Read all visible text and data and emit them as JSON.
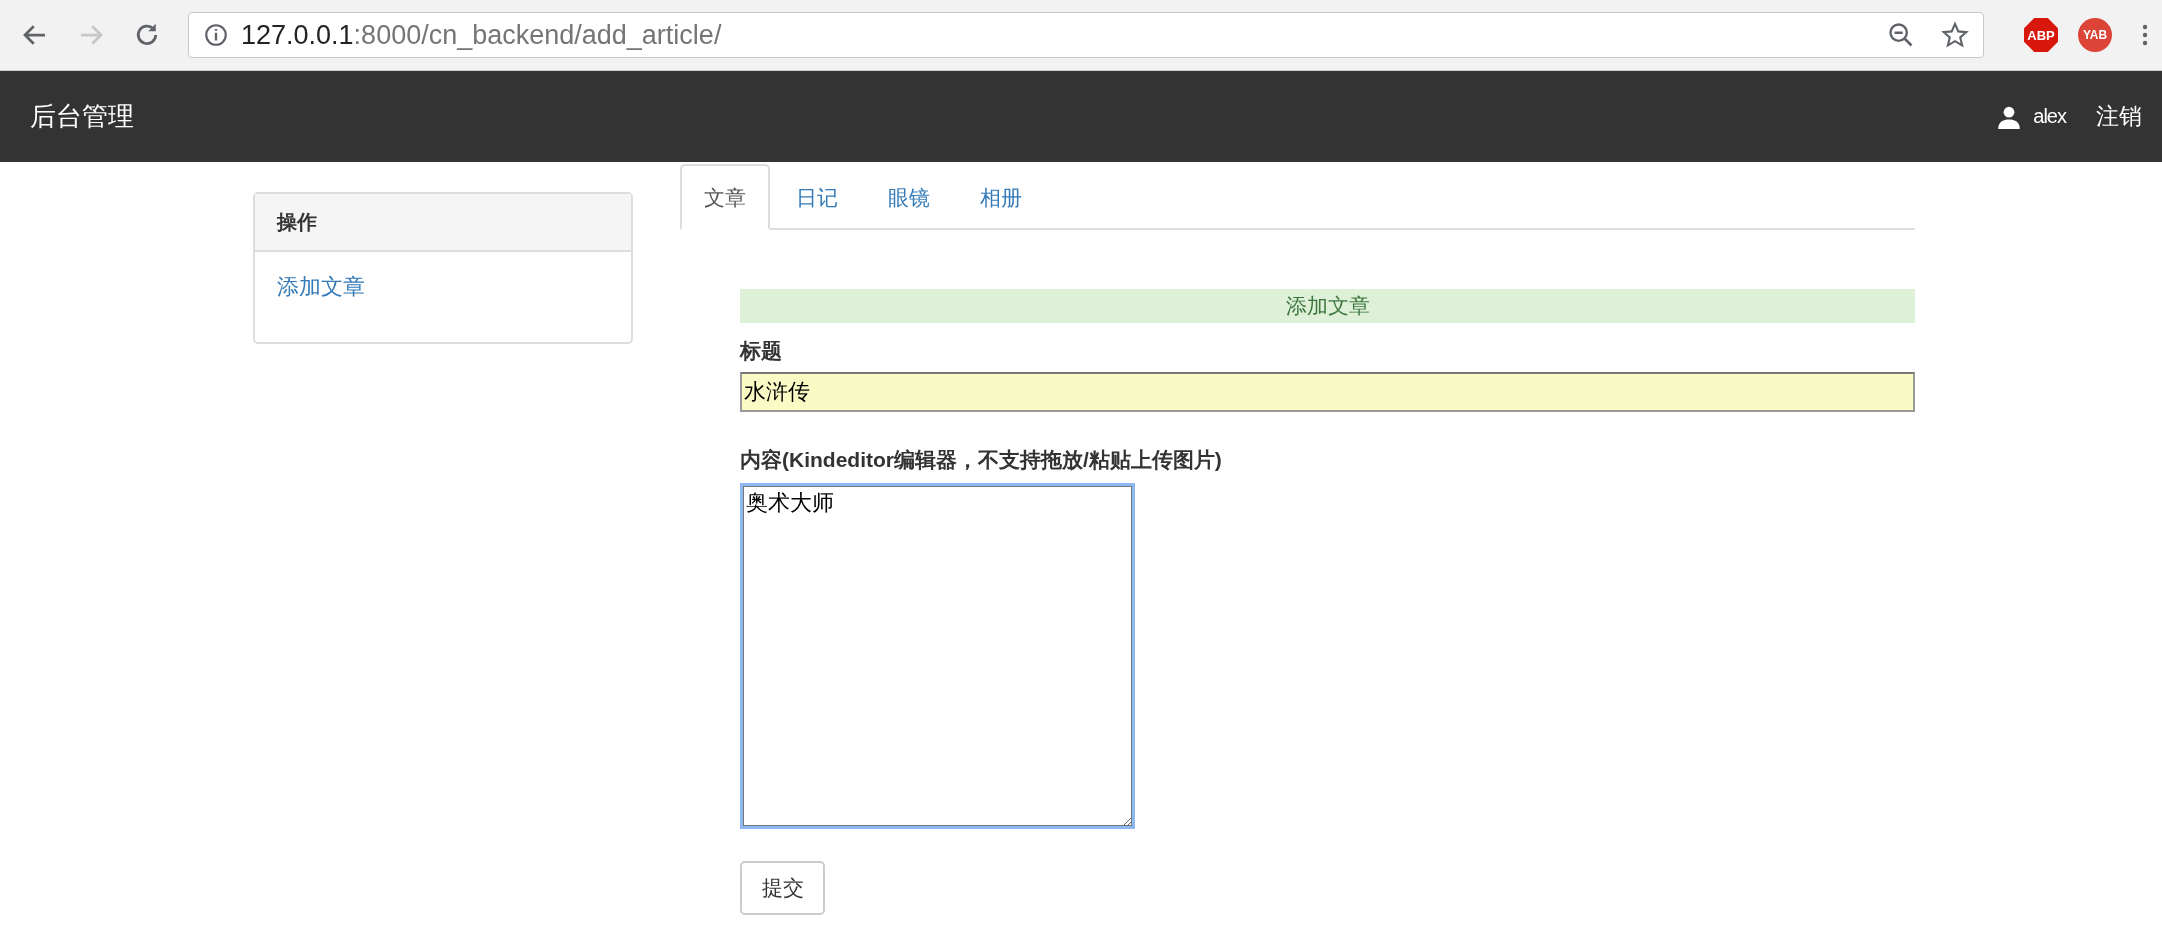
{
  "browser": {
    "url_host": "127.0.0.1",
    "url_path": ":8000/cn_backend/add_article/",
    "extensions": [
      {
        "label": "ABP",
        "kind": "octagon"
      },
      {
        "label": "YAB",
        "kind": "circle"
      }
    ]
  },
  "navbar": {
    "brand": "后台管理",
    "user": "alex",
    "logout": "注销"
  },
  "sidebar": {
    "heading": "操作",
    "items": [
      "添加文章"
    ]
  },
  "tabs": [
    {
      "label": "文章",
      "selected": true
    },
    {
      "label": "日记",
      "selected": false
    },
    {
      "label": "眼镜",
      "selected": false
    },
    {
      "label": "相册",
      "selected": false
    }
  ],
  "form": {
    "banner": "添加文章",
    "title_label": "标题",
    "title_value": "水浒传",
    "content_label": "内容(Kindeditor编辑器，不支持拖放/粘贴上传图片)",
    "content_value": "奥术大师",
    "submit": "提交"
  }
}
